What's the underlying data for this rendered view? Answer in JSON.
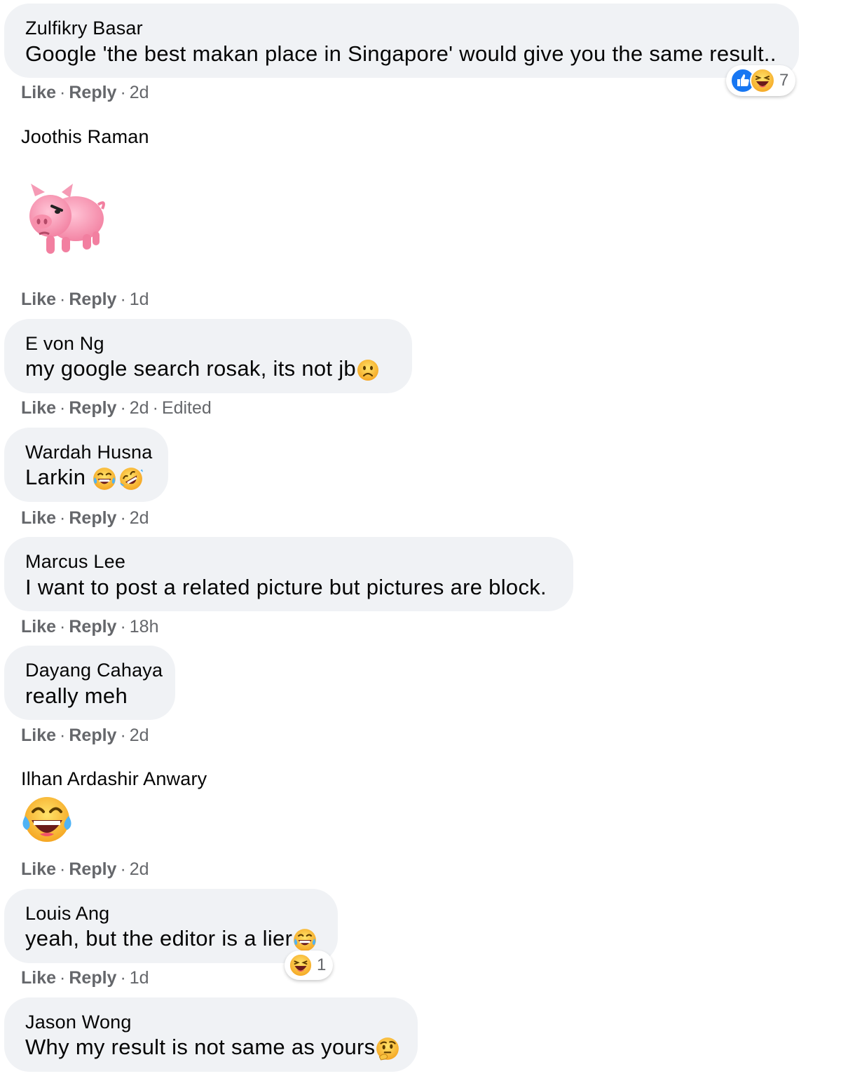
{
  "comments": [
    {
      "name": "Zulfikry Basar",
      "text": "Google 'the best makan place in Singapore' would give you the same result..",
      "like": "Like",
      "reply": "Reply",
      "time": "2d",
      "reaction_count": "7"
    },
    {
      "name": "Joothis Raman",
      "like": "Like",
      "reply": "Reply",
      "time": "1d",
      "sticker": "angry-pig-sticker"
    },
    {
      "name": "E von Ng",
      "text": "my google search rosak,  its not jb",
      "like": "Like",
      "reply": "Reply",
      "time": "2d",
      "edited": "Edited"
    },
    {
      "name": "Wardah Husna",
      "text": "Larkin",
      "like": "Like",
      "reply": "Reply",
      "time": "2d"
    },
    {
      "name": "Marcus Lee",
      "text": "I want to post a related picture but pictures are block.",
      "like": "Like",
      "reply": "Reply",
      "time": "18h"
    },
    {
      "name": "Dayang Cahaya",
      "text": "really meh",
      "like": "Like",
      "reply": "Reply",
      "time": "2d"
    },
    {
      "name": "Ilhan Ardashir Anwary",
      "like": "Like",
      "reply": "Reply",
      "time": "2d"
    },
    {
      "name": "Louis Ang",
      "text": "yeah, but the editor is a lier",
      "like": "Like",
      "reply": "Reply",
      "time": "1d",
      "reaction_count": "1"
    },
    {
      "name": "Jason Wong",
      "text": "Why my result is not same as yours"
    }
  ],
  "separator": "·",
  "colors": {
    "bubble": "#f0f2f5",
    "meta": "#65676b",
    "like_blue": "#1877f2",
    "emoji_yellow": "#f7b125"
  }
}
